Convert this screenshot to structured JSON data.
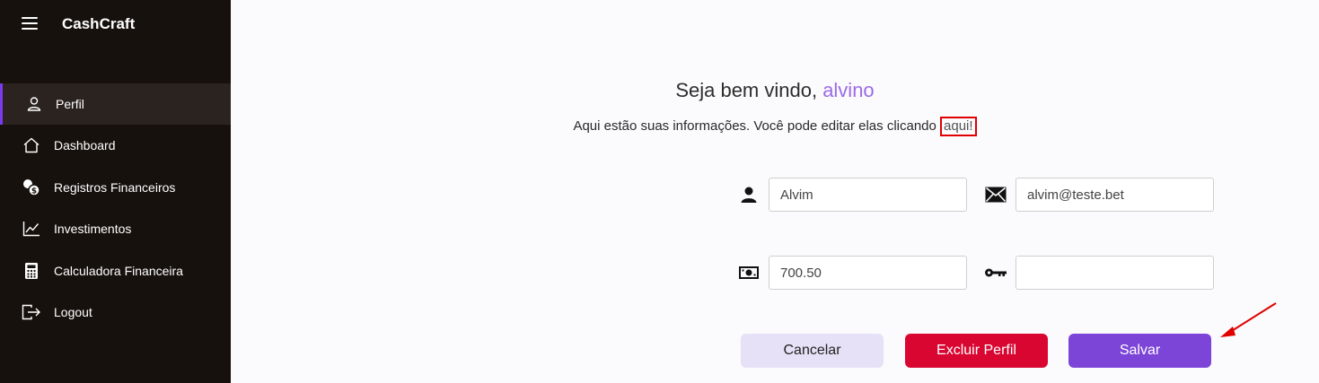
{
  "app": {
    "brand": "CashCraft"
  },
  "sidebar": {
    "items": [
      {
        "label": "Perfil",
        "icon": "user-icon",
        "active": true
      },
      {
        "label": "Dashboard",
        "icon": "home-icon",
        "active": false
      },
      {
        "label": "Registros Financeiros",
        "icon": "coins-icon",
        "active": false
      },
      {
        "label": "Investimentos",
        "icon": "chart-line-icon",
        "active": false
      },
      {
        "label": "Calculadora Financeira",
        "icon": "calculator-icon",
        "active": false
      },
      {
        "label": "Logout",
        "icon": "logout-icon",
        "active": false
      }
    ]
  },
  "main": {
    "welcome_prefix": "Seja bem vindo, ",
    "welcome_name": "alvino",
    "subtitle": "Aqui estão suas informações. Você pode editar elas clicando ",
    "edit_link": "aqui!",
    "fields": {
      "name": {
        "value": "Alvim",
        "icon": "person-icon"
      },
      "email": {
        "value": "alvim@teste.bet",
        "icon": "envelope-icon"
      },
      "balance": {
        "value": "700.50",
        "icon": "money-icon"
      },
      "password": {
        "value": "",
        "icon": "key-icon"
      }
    },
    "buttons": {
      "cancel": "Cancelar",
      "delete": "Excluir Perfil",
      "save": "Salvar"
    }
  },
  "colors": {
    "sidebar_bg": "#17110e",
    "accent": "#7c45d8",
    "danger": "#d90632",
    "highlight": "#e00000"
  }
}
